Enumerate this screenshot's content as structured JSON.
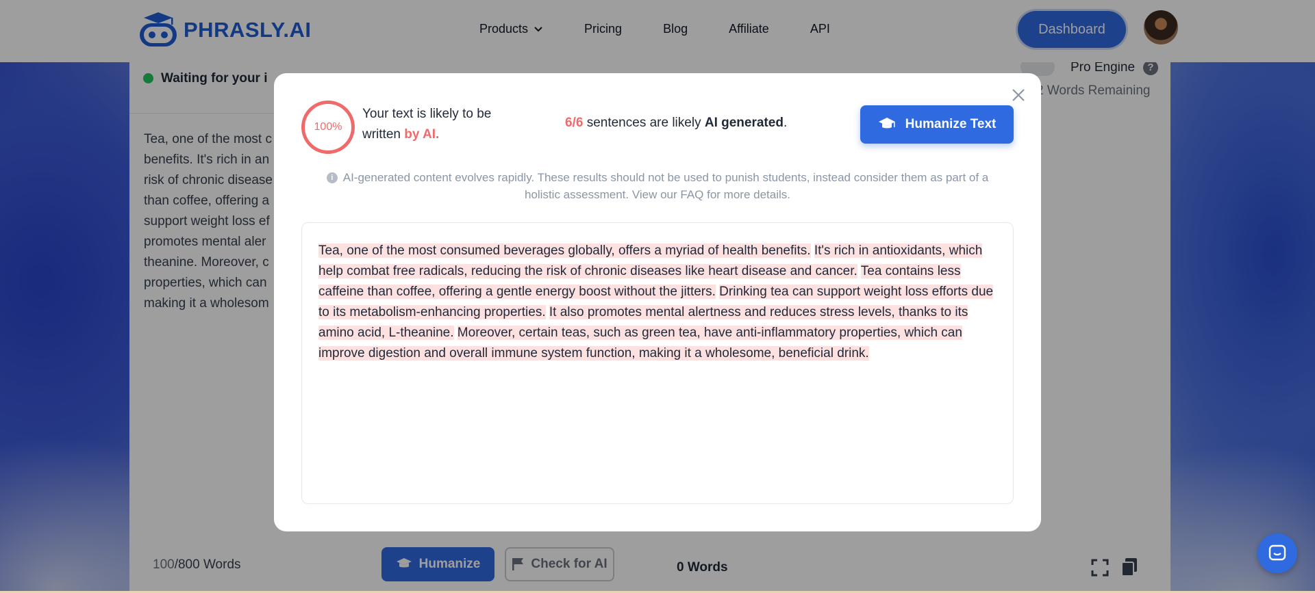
{
  "navbar": {
    "logo_text": "PHRASLY.AI",
    "links": [
      "Products",
      "Pricing",
      "Blog",
      "Affiliate",
      "API"
    ],
    "dashboard_label": "Dashboard"
  },
  "left_panel": {
    "status_text": "Waiting for your i",
    "preview_lines": "Tea, one of the most c\nbenefits. It's rich in an\nrisk of chronic disease\nthan coffee, offering a\nsupport weight loss ef\npromotes mental aler\ntheanine. Moreover, c\nproperties, which can\nmaking it a wholesom",
    "word_count_current": "100",
    "word_count_total": "/800 Words",
    "humanize_label": "Humanize",
    "check_label": "Check for AI"
  },
  "right_panel": {
    "pro_engine_label": "Pro Engine",
    "help_label": "?",
    "words_remaining": "2 Words Remaining",
    "word_count": "0 Words"
  },
  "modal": {
    "score": "100%",
    "likely_prefix": "Your text is likely to be written ",
    "likely_suffix": "by AI.",
    "sentences_ratio": "6/6",
    "sentences_middle": " sentences are likely ",
    "sentences_bold": "AI generated",
    "sentences_end": ".",
    "humanize_label": "Humanize Text",
    "disclaimer": "AI-generated content evolves rapidly. These results should not be used to punish students, instead consider them as part of a holistic assessment. View our FAQ for more details.",
    "sentences": [
      "Tea, one of the most consumed beverages globally, offers a myriad of health benefits.",
      "It's rich in antioxidants, which help combat free radicals, reducing the risk of chronic diseases like heart disease and cancer.",
      "Tea contains less caffeine than coffee, offering a gentle energy boost without the jitters.",
      "Drinking tea can support weight loss efforts due to its metabolism-enhancing properties.",
      "It also promotes mental alertness and reduces stress levels, thanks to its amino acid, L-theanine.",
      "Moreover, certain teas, such as green tea, have anti-inflammatory properties, which can improve digestion and overall immune system function, making it a wholesome, beneficial drink."
    ]
  },
  "colors": {
    "accent": "#2f6ae0",
    "ai_red": "#ef6b6b",
    "highlight": "#fde1e1"
  }
}
